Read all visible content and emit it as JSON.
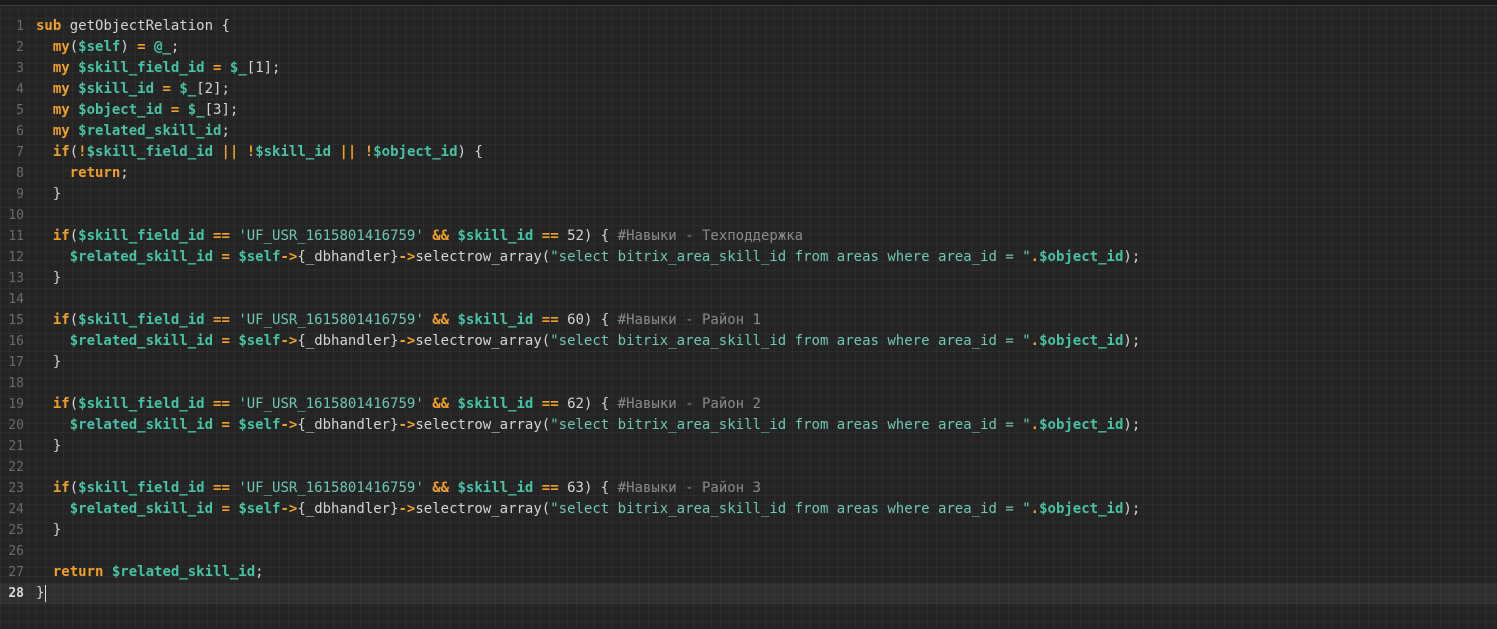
{
  "editor": {
    "active_line": 28,
    "line_numbers": [
      "1",
      "2",
      "3",
      "4",
      "5",
      "6",
      "7",
      "8",
      "9",
      "10",
      "11",
      "12",
      "13",
      "14",
      "15",
      "16",
      "17",
      "18",
      "19",
      "20",
      "21",
      "22",
      "23",
      "24",
      "25",
      "26",
      "27",
      "28"
    ],
    "lines": [
      [
        {
          "t": "kw",
          "v": "sub"
        },
        {
          "t": "plain",
          "v": " getObjectRelation {"
        }
      ],
      [
        {
          "t": "plain",
          "v": "  "
        },
        {
          "t": "kw",
          "v": "my"
        },
        {
          "t": "plain",
          "v": "("
        },
        {
          "t": "var",
          "v": "$self"
        },
        {
          "t": "plain",
          "v": ") "
        },
        {
          "t": "op",
          "v": "="
        },
        {
          "t": "plain",
          "v": " "
        },
        {
          "t": "var",
          "v": "@_"
        },
        {
          "t": "plain",
          "v": ";"
        }
      ],
      [
        {
          "t": "plain",
          "v": "  "
        },
        {
          "t": "kw",
          "v": "my"
        },
        {
          "t": "plain",
          "v": " "
        },
        {
          "t": "var",
          "v": "$skill_field_id"
        },
        {
          "t": "plain",
          "v": " "
        },
        {
          "t": "op",
          "v": "="
        },
        {
          "t": "plain",
          "v": " "
        },
        {
          "t": "var",
          "v": "$_"
        },
        {
          "t": "plain",
          "v": "[1];"
        }
      ],
      [
        {
          "t": "plain",
          "v": "  "
        },
        {
          "t": "kw",
          "v": "my"
        },
        {
          "t": "plain",
          "v": " "
        },
        {
          "t": "var",
          "v": "$skill_id"
        },
        {
          "t": "plain",
          "v": " "
        },
        {
          "t": "op",
          "v": "="
        },
        {
          "t": "plain",
          "v": " "
        },
        {
          "t": "var",
          "v": "$_"
        },
        {
          "t": "plain",
          "v": "[2];"
        }
      ],
      [
        {
          "t": "plain",
          "v": "  "
        },
        {
          "t": "kw",
          "v": "my"
        },
        {
          "t": "plain",
          "v": " "
        },
        {
          "t": "var",
          "v": "$object_id"
        },
        {
          "t": "plain",
          "v": " "
        },
        {
          "t": "op",
          "v": "="
        },
        {
          "t": "plain",
          "v": " "
        },
        {
          "t": "var",
          "v": "$_"
        },
        {
          "t": "plain",
          "v": "[3];"
        }
      ],
      [
        {
          "t": "plain",
          "v": "  "
        },
        {
          "t": "kw",
          "v": "my"
        },
        {
          "t": "plain",
          "v": " "
        },
        {
          "t": "var",
          "v": "$related_skill_id"
        },
        {
          "t": "plain",
          "v": ";"
        }
      ],
      [
        {
          "t": "plain",
          "v": "  "
        },
        {
          "t": "kw",
          "v": "if"
        },
        {
          "t": "plain",
          "v": "("
        },
        {
          "t": "op",
          "v": "!"
        },
        {
          "t": "var",
          "v": "$skill_field_id"
        },
        {
          "t": "plain",
          "v": " "
        },
        {
          "t": "op",
          "v": "||"
        },
        {
          "t": "plain",
          "v": " "
        },
        {
          "t": "op",
          "v": "!"
        },
        {
          "t": "var",
          "v": "$skill_id"
        },
        {
          "t": "plain",
          "v": " "
        },
        {
          "t": "op",
          "v": "||"
        },
        {
          "t": "plain",
          "v": " "
        },
        {
          "t": "op",
          "v": "!"
        },
        {
          "t": "var",
          "v": "$object_id"
        },
        {
          "t": "plain",
          "v": ") {"
        }
      ],
      [
        {
          "t": "plain",
          "v": "    "
        },
        {
          "t": "kw",
          "v": "return"
        },
        {
          "t": "plain",
          "v": ";"
        }
      ],
      [
        {
          "t": "plain",
          "v": "  }"
        }
      ],
      [
        {
          "t": "plain",
          "v": ""
        }
      ],
      [
        {
          "t": "plain",
          "v": "  "
        },
        {
          "t": "kw",
          "v": "if"
        },
        {
          "t": "plain",
          "v": "("
        },
        {
          "t": "var",
          "v": "$skill_field_id"
        },
        {
          "t": "plain",
          "v": " "
        },
        {
          "t": "op",
          "v": "=="
        },
        {
          "t": "plain",
          "v": " "
        },
        {
          "t": "str",
          "v": "'UF_USR_1615801416759'"
        },
        {
          "t": "plain",
          "v": " "
        },
        {
          "t": "op",
          "v": "&&"
        },
        {
          "t": "plain",
          "v": " "
        },
        {
          "t": "var",
          "v": "$skill_id"
        },
        {
          "t": "plain",
          "v": " "
        },
        {
          "t": "op",
          "v": "=="
        },
        {
          "t": "plain",
          "v": " 52) { "
        },
        {
          "t": "com",
          "v": "#Навыки - Техподдержка"
        }
      ],
      [
        {
          "t": "plain",
          "v": "    "
        },
        {
          "t": "var",
          "v": "$related_skill_id"
        },
        {
          "t": "plain",
          "v": " "
        },
        {
          "t": "op",
          "v": "="
        },
        {
          "t": "plain",
          "v": " "
        },
        {
          "t": "var",
          "v": "$self"
        },
        {
          "t": "op",
          "v": "->"
        },
        {
          "t": "plain",
          "v": "{_dbhandler}"
        },
        {
          "t": "op",
          "v": "->"
        },
        {
          "t": "plain",
          "v": "selectrow_array("
        },
        {
          "t": "str",
          "v": "\"select bitrix_area_skill_id from areas where area_id = \""
        },
        {
          "t": "op",
          "v": "."
        },
        {
          "t": "var",
          "v": "$object_id"
        },
        {
          "t": "plain",
          "v": ");"
        }
      ],
      [
        {
          "t": "plain",
          "v": "  }"
        }
      ],
      [
        {
          "t": "plain",
          "v": ""
        }
      ],
      [
        {
          "t": "plain",
          "v": "  "
        },
        {
          "t": "kw",
          "v": "if"
        },
        {
          "t": "plain",
          "v": "("
        },
        {
          "t": "var",
          "v": "$skill_field_id"
        },
        {
          "t": "plain",
          "v": " "
        },
        {
          "t": "op",
          "v": "=="
        },
        {
          "t": "plain",
          "v": " "
        },
        {
          "t": "str",
          "v": "'UF_USR_1615801416759'"
        },
        {
          "t": "plain",
          "v": " "
        },
        {
          "t": "op",
          "v": "&&"
        },
        {
          "t": "plain",
          "v": " "
        },
        {
          "t": "var",
          "v": "$skill_id"
        },
        {
          "t": "plain",
          "v": " "
        },
        {
          "t": "op",
          "v": "=="
        },
        {
          "t": "plain",
          "v": " 60) { "
        },
        {
          "t": "com",
          "v": "#Навыки - Район 1"
        }
      ],
      [
        {
          "t": "plain",
          "v": "    "
        },
        {
          "t": "var",
          "v": "$related_skill_id"
        },
        {
          "t": "plain",
          "v": " "
        },
        {
          "t": "op",
          "v": "="
        },
        {
          "t": "plain",
          "v": " "
        },
        {
          "t": "var",
          "v": "$self"
        },
        {
          "t": "op",
          "v": "->"
        },
        {
          "t": "plain",
          "v": "{_dbhandler}"
        },
        {
          "t": "op",
          "v": "->"
        },
        {
          "t": "plain",
          "v": "selectrow_array("
        },
        {
          "t": "str",
          "v": "\"select bitrix_area_skill_id from areas where area_id = \""
        },
        {
          "t": "op",
          "v": "."
        },
        {
          "t": "var",
          "v": "$object_id"
        },
        {
          "t": "plain",
          "v": ");"
        }
      ],
      [
        {
          "t": "plain",
          "v": "  }"
        }
      ],
      [
        {
          "t": "plain",
          "v": ""
        }
      ],
      [
        {
          "t": "plain",
          "v": "  "
        },
        {
          "t": "kw",
          "v": "if"
        },
        {
          "t": "plain",
          "v": "("
        },
        {
          "t": "var",
          "v": "$skill_field_id"
        },
        {
          "t": "plain",
          "v": " "
        },
        {
          "t": "op",
          "v": "=="
        },
        {
          "t": "plain",
          "v": " "
        },
        {
          "t": "str",
          "v": "'UF_USR_1615801416759'"
        },
        {
          "t": "plain",
          "v": " "
        },
        {
          "t": "op",
          "v": "&&"
        },
        {
          "t": "plain",
          "v": " "
        },
        {
          "t": "var",
          "v": "$skill_id"
        },
        {
          "t": "plain",
          "v": " "
        },
        {
          "t": "op",
          "v": "=="
        },
        {
          "t": "plain",
          "v": " 62) { "
        },
        {
          "t": "com",
          "v": "#Навыки - Район 2"
        }
      ],
      [
        {
          "t": "plain",
          "v": "    "
        },
        {
          "t": "var",
          "v": "$related_skill_id"
        },
        {
          "t": "plain",
          "v": " "
        },
        {
          "t": "op",
          "v": "="
        },
        {
          "t": "plain",
          "v": " "
        },
        {
          "t": "var",
          "v": "$self"
        },
        {
          "t": "op",
          "v": "->"
        },
        {
          "t": "plain",
          "v": "{_dbhandler}"
        },
        {
          "t": "op",
          "v": "->"
        },
        {
          "t": "plain",
          "v": "selectrow_array("
        },
        {
          "t": "str",
          "v": "\"select bitrix_area_skill_id from areas where area_id = \""
        },
        {
          "t": "op",
          "v": "."
        },
        {
          "t": "var",
          "v": "$object_id"
        },
        {
          "t": "plain",
          "v": ");"
        }
      ],
      [
        {
          "t": "plain",
          "v": "  }"
        }
      ],
      [
        {
          "t": "plain",
          "v": ""
        }
      ],
      [
        {
          "t": "plain",
          "v": "  "
        },
        {
          "t": "kw",
          "v": "if"
        },
        {
          "t": "plain",
          "v": "("
        },
        {
          "t": "var",
          "v": "$skill_field_id"
        },
        {
          "t": "plain",
          "v": " "
        },
        {
          "t": "op",
          "v": "=="
        },
        {
          "t": "plain",
          "v": " "
        },
        {
          "t": "str",
          "v": "'UF_USR_1615801416759'"
        },
        {
          "t": "plain",
          "v": " "
        },
        {
          "t": "op",
          "v": "&&"
        },
        {
          "t": "plain",
          "v": " "
        },
        {
          "t": "var",
          "v": "$skill_id"
        },
        {
          "t": "plain",
          "v": " "
        },
        {
          "t": "op",
          "v": "=="
        },
        {
          "t": "plain",
          "v": " 63) { "
        },
        {
          "t": "com",
          "v": "#Навыки - Район 3"
        }
      ],
      [
        {
          "t": "plain",
          "v": "    "
        },
        {
          "t": "var",
          "v": "$related_skill_id"
        },
        {
          "t": "plain",
          "v": " "
        },
        {
          "t": "op",
          "v": "="
        },
        {
          "t": "plain",
          "v": " "
        },
        {
          "t": "var",
          "v": "$self"
        },
        {
          "t": "op",
          "v": "->"
        },
        {
          "t": "plain",
          "v": "{_dbhandler}"
        },
        {
          "t": "op",
          "v": "->"
        },
        {
          "t": "plain",
          "v": "selectrow_array("
        },
        {
          "t": "str",
          "v": "\"select bitrix_area_skill_id from areas where area_id = \""
        },
        {
          "t": "op",
          "v": "."
        },
        {
          "t": "var",
          "v": "$object_id"
        },
        {
          "t": "plain",
          "v": ");"
        }
      ],
      [
        {
          "t": "plain",
          "v": "  }"
        }
      ],
      [
        {
          "t": "plain",
          "v": ""
        }
      ],
      [
        {
          "t": "plain",
          "v": "  "
        },
        {
          "t": "kw",
          "v": "return"
        },
        {
          "t": "plain",
          "v": " "
        },
        {
          "t": "var",
          "v": "$related_skill_id"
        },
        {
          "t": "plain",
          "v": ";"
        }
      ],
      [
        {
          "t": "plain",
          "v": "}"
        }
      ]
    ]
  }
}
